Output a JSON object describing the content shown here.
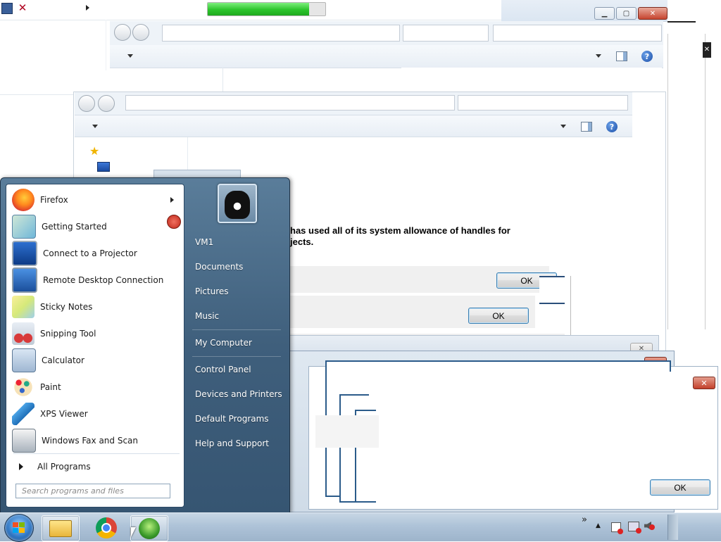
{
  "progress": {
    "fraction": 0.86
  },
  "dialog": {
    "message_line1": "has used all of its system allowance of handles for",
    "message_line2": "jects.",
    "ok_label": "OK"
  },
  "start_menu": {
    "user_name": "VM1",
    "programs": [
      {
        "label": "Firefox",
        "icon": "firefox-icon",
        "has_submenu": true
      },
      {
        "label": "Getting Started",
        "icon": "getting-started-icon"
      },
      {
        "label": "Connect to a Projector",
        "icon": "projector-icon"
      },
      {
        "label": "Remote Desktop Connection",
        "icon": "remote-desktop-icon"
      },
      {
        "label": "Sticky Notes",
        "icon": "sticky-notes-icon"
      },
      {
        "label": "Snipping Tool",
        "icon": "snipping-tool-icon"
      },
      {
        "label": "Calculator",
        "icon": "calculator-icon"
      },
      {
        "label": "Paint",
        "icon": "paint-icon"
      },
      {
        "label": "XPS Viewer",
        "icon": "xps-viewer-icon"
      },
      {
        "label": "Windows Fax and Scan",
        "icon": "fax-scan-icon"
      }
    ],
    "all_programs": "All Programs",
    "search_placeholder": "Search programs and files",
    "right_items": [
      "VM1",
      "Documents",
      "Pictures",
      "Music",
      "My Computer",
      "Control Panel",
      "Devices and Printers",
      "Default Programs",
      "Help and Support"
    ]
  },
  "taskbar": {
    "tray_overflow": "»",
    "tray_up": "▲"
  },
  "colors": {
    "start_menu_bg": "#4a6b88",
    "taskbar_bg": "#aec3d8",
    "progress_green": "#3bd43b",
    "button_border": "#3c7fb1"
  }
}
